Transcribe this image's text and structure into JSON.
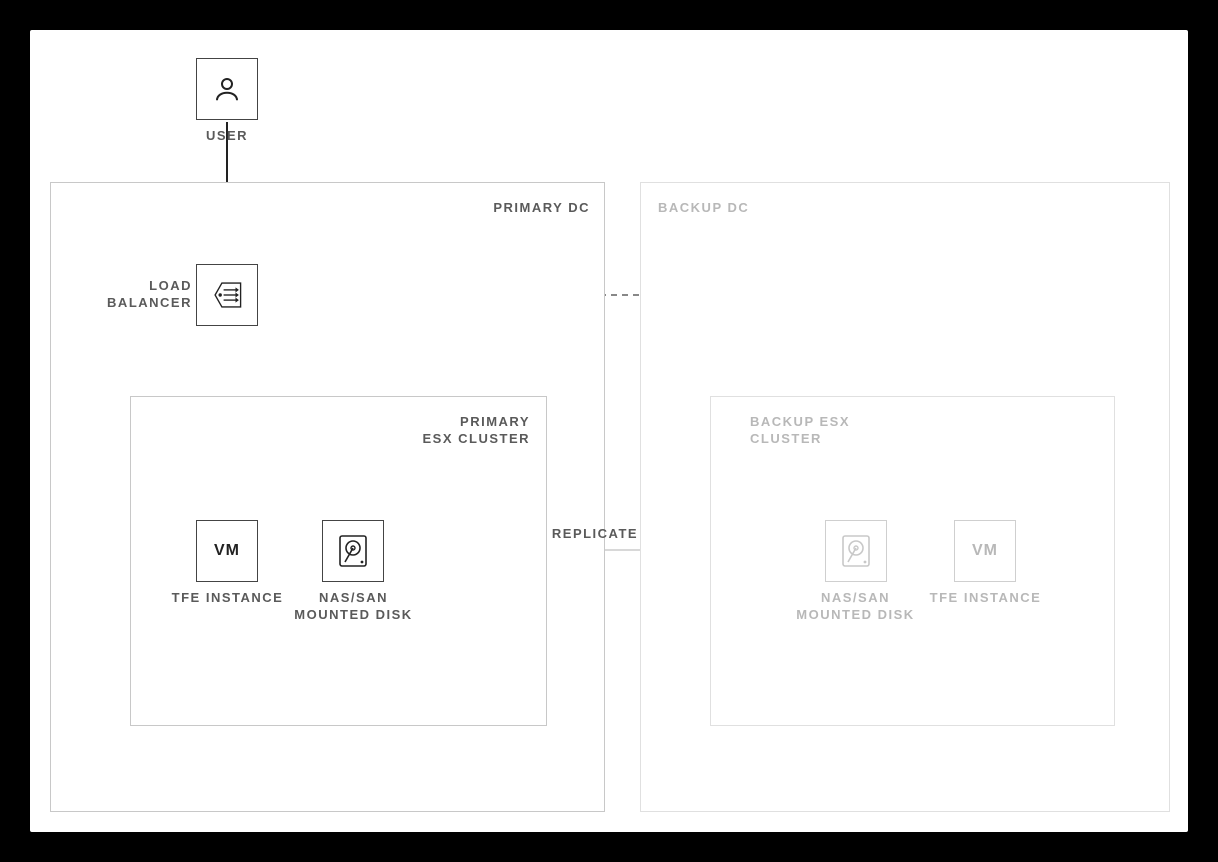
{
  "user": {
    "label": "USER"
  },
  "primary_dc": {
    "title": "PRIMARY DC",
    "load_balancer_label": "LOAD\nBALANCER",
    "cluster_title": "PRIMARY\nESX CLUSTER",
    "vm_label": "VM",
    "tfe_label": "TFE INSTANCE",
    "disk_label": "NAS/SAN\nMOUNTED DISK"
  },
  "backup_dc": {
    "title": "BACKUP DC",
    "cluster_title": "BACKUP ESX\nCLUSTER",
    "vm_label": "VM",
    "tfe_label": "TFE INSTANCE",
    "disk_label": "NAS/SAN\nMOUNTED DISK"
  },
  "edges": {
    "replicate": "REPLICATE"
  }
}
